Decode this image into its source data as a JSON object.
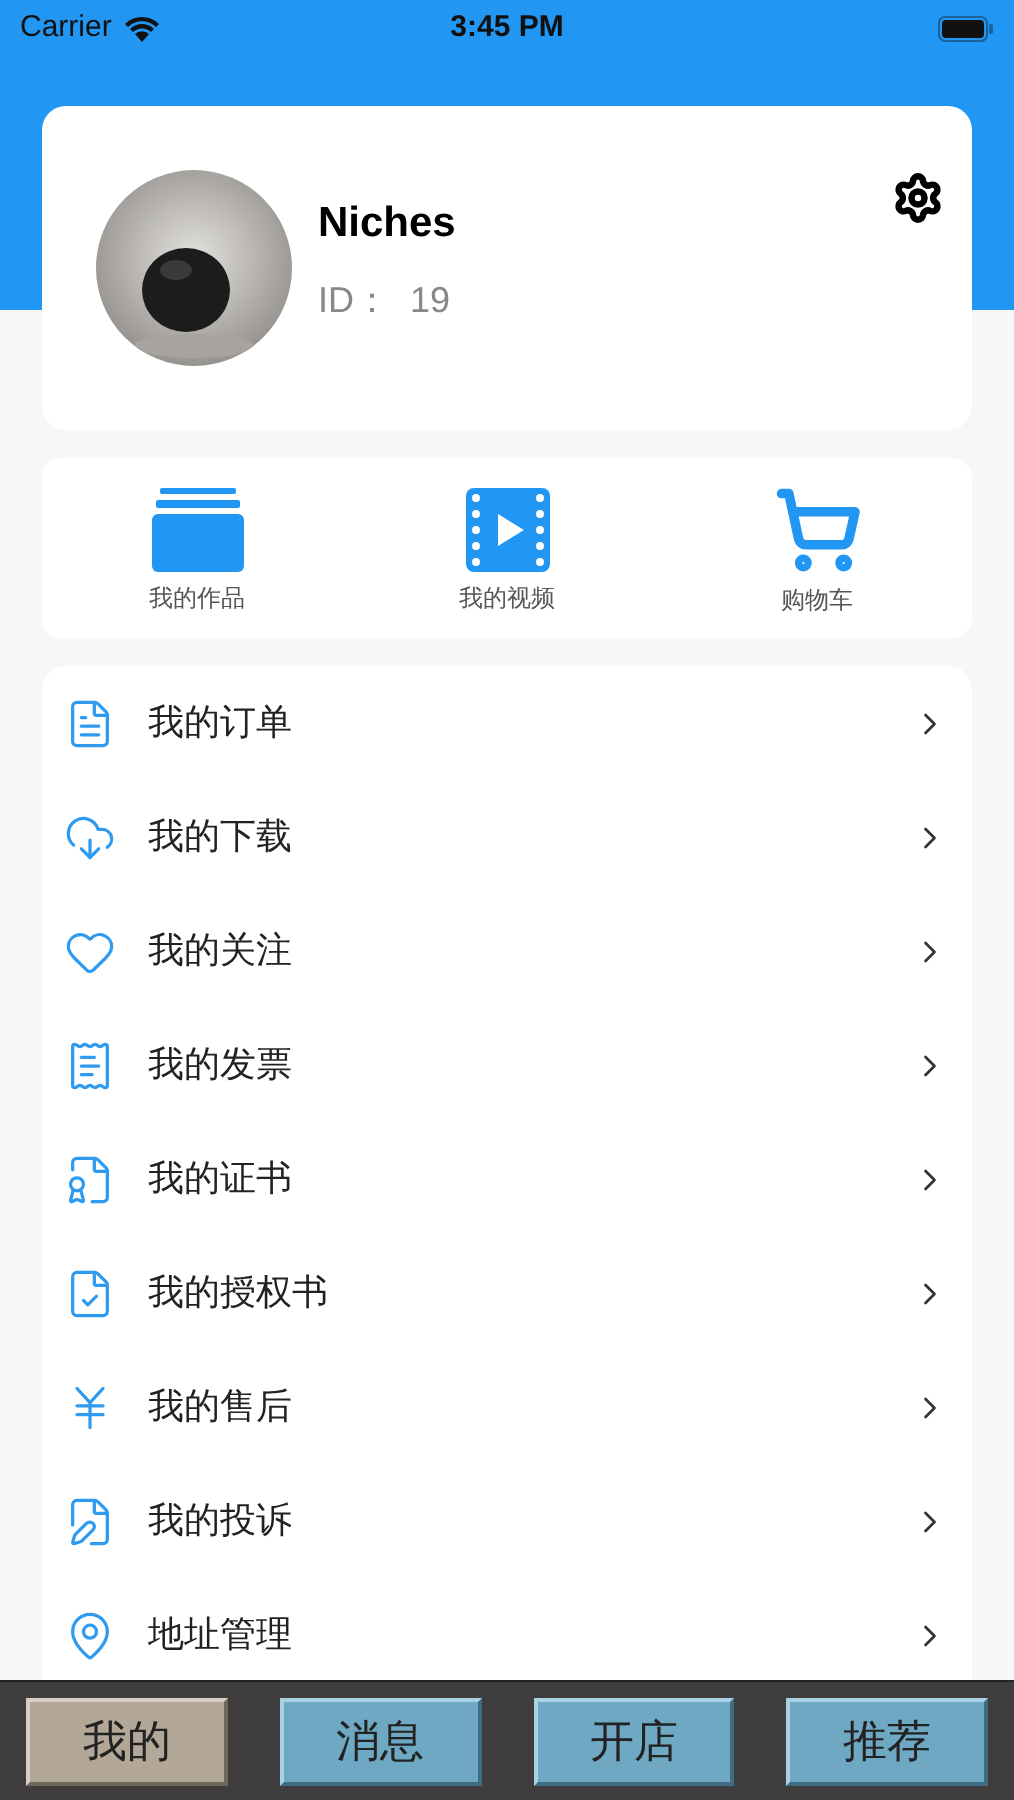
{
  "status_bar": {
    "carrier": "Carrier",
    "time": "3:45 PM"
  },
  "profile": {
    "name": "Niches",
    "id": "ID：  19"
  },
  "quick_links": [
    {
      "label": "我的作品",
      "kind": "works"
    },
    {
      "label": "我的视频",
      "kind": "video"
    },
    {
      "label": "购物车",
      "kind": "cart"
    }
  ],
  "menu": [
    {
      "label": "我的订单",
      "kind": "order"
    },
    {
      "label": "我的下载",
      "kind": "download"
    },
    {
      "label": "我的关注",
      "kind": "follow"
    },
    {
      "label": "我的发票",
      "kind": "invoice"
    },
    {
      "label": "我的证书",
      "kind": "certificate"
    },
    {
      "label": "我的授权书",
      "kind": "authorization"
    },
    {
      "label": "我的售后",
      "kind": "aftersale"
    },
    {
      "label": "我的投诉",
      "kind": "complaint"
    },
    {
      "label": "地址管理",
      "kind": "address"
    }
  ],
  "tab_bar": [
    {
      "label": "我的",
      "selected": true
    },
    {
      "label": "消息",
      "selected": false
    },
    {
      "label": "开店",
      "selected": false
    },
    {
      "label": "推荐",
      "selected": false
    }
  ]
}
